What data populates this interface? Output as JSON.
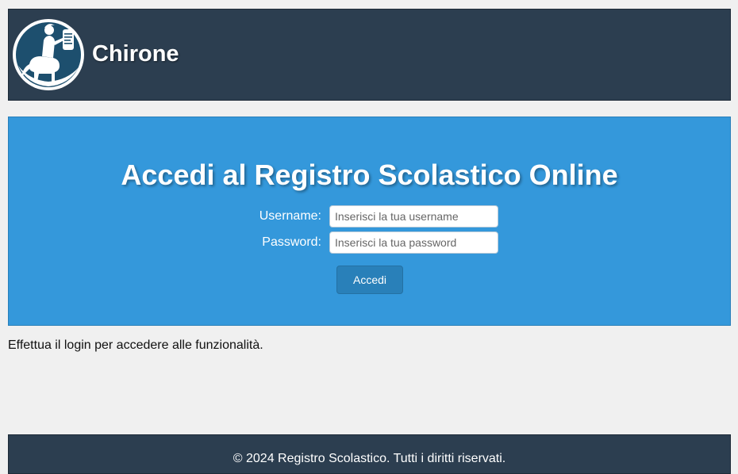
{
  "header": {
    "brand": "Chirone",
    "logo_icon": "centaur-logo-icon",
    "background": "#2c3e50"
  },
  "login": {
    "title": "Accedi al Registro Scolastico Online",
    "username_label": "Username:",
    "username_placeholder": "Inserisci la tua username",
    "username_value": "",
    "password_label": "Password:",
    "password_placeholder": "Inserisci la tua password",
    "password_value": "",
    "submit_label": "Accedi",
    "background": "#3498db",
    "button_color": "#2980b9"
  },
  "main": {
    "message": "Effettua il login per accedere alle funzionalità."
  },
  "footer": {
    "text": "© 2024 Registro Scolastico. Tutti i diritti riservati."
  }
}
